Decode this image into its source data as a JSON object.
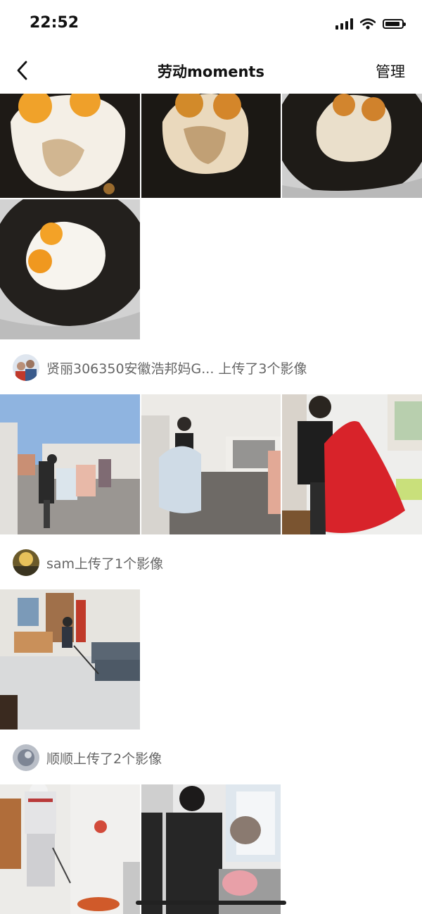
{
  "status": {
    "time": "22:52"
  },
  "nav": {
    "title": "劳动moments",
    "manage_label": "管理"
  },
  "uploads": [
    {
      "text": "贤丽306350安徽浩邦妈G... 上传了3个影像"
    },
    {
      "text": "sam上传了1个影像"
    },
    {
      "text": "顺顺上传了2个影像"
    }
  ],
  "colors": {
    "background": "#ffffff",
    "text_secondary": "#666666",
    "indicator": "#222222"
  }
}
